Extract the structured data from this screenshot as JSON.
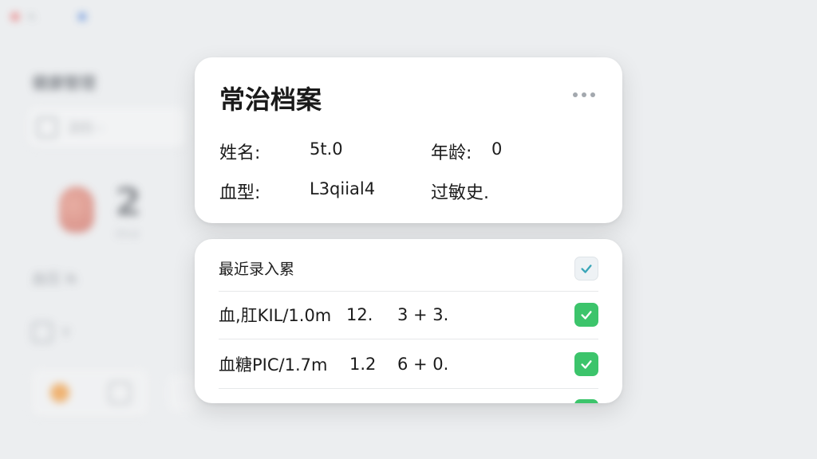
{
  "background": {
    "tab_text": "⁕.",
    "title": "健康管理",
    "search_text": "2(l) -",
    "big_number": "2",
    "small_text": "小s p",
    "row1": "血压 lk",
    "row2": "Y"
  },
  "profile": {
    "title": "常治档案",
    "name_label": "姓名:",
    "name_value": "5t.0",
    "age_label": "年龄:",
    "age_value": "0",
    "blood_label": "血型:",
    "blood_value": "L3qiial4",
    "allergy_label": "过敏史."
  },
  "records": {
    "header": "最近录入累",
    "rows": [
      {
        "name": "血,肛KIL/1.0m",
        "a": "12.",
        "b": "3 + 3."
      },
      {
        "name": "血糖PIC/1.7m",
        "a": "1.2",
        "b": "6 + 0."
      },
      {
        "name": "",
        "a": "",
        "b": ""
      }
    ]
  },
  "colors": {
    "check_green": "#3cc46b",
    "check_teal": "#3aa6b8",
    "card_bg": "#ffffff",
    "page_bg": "#eceef0"
  }
}
